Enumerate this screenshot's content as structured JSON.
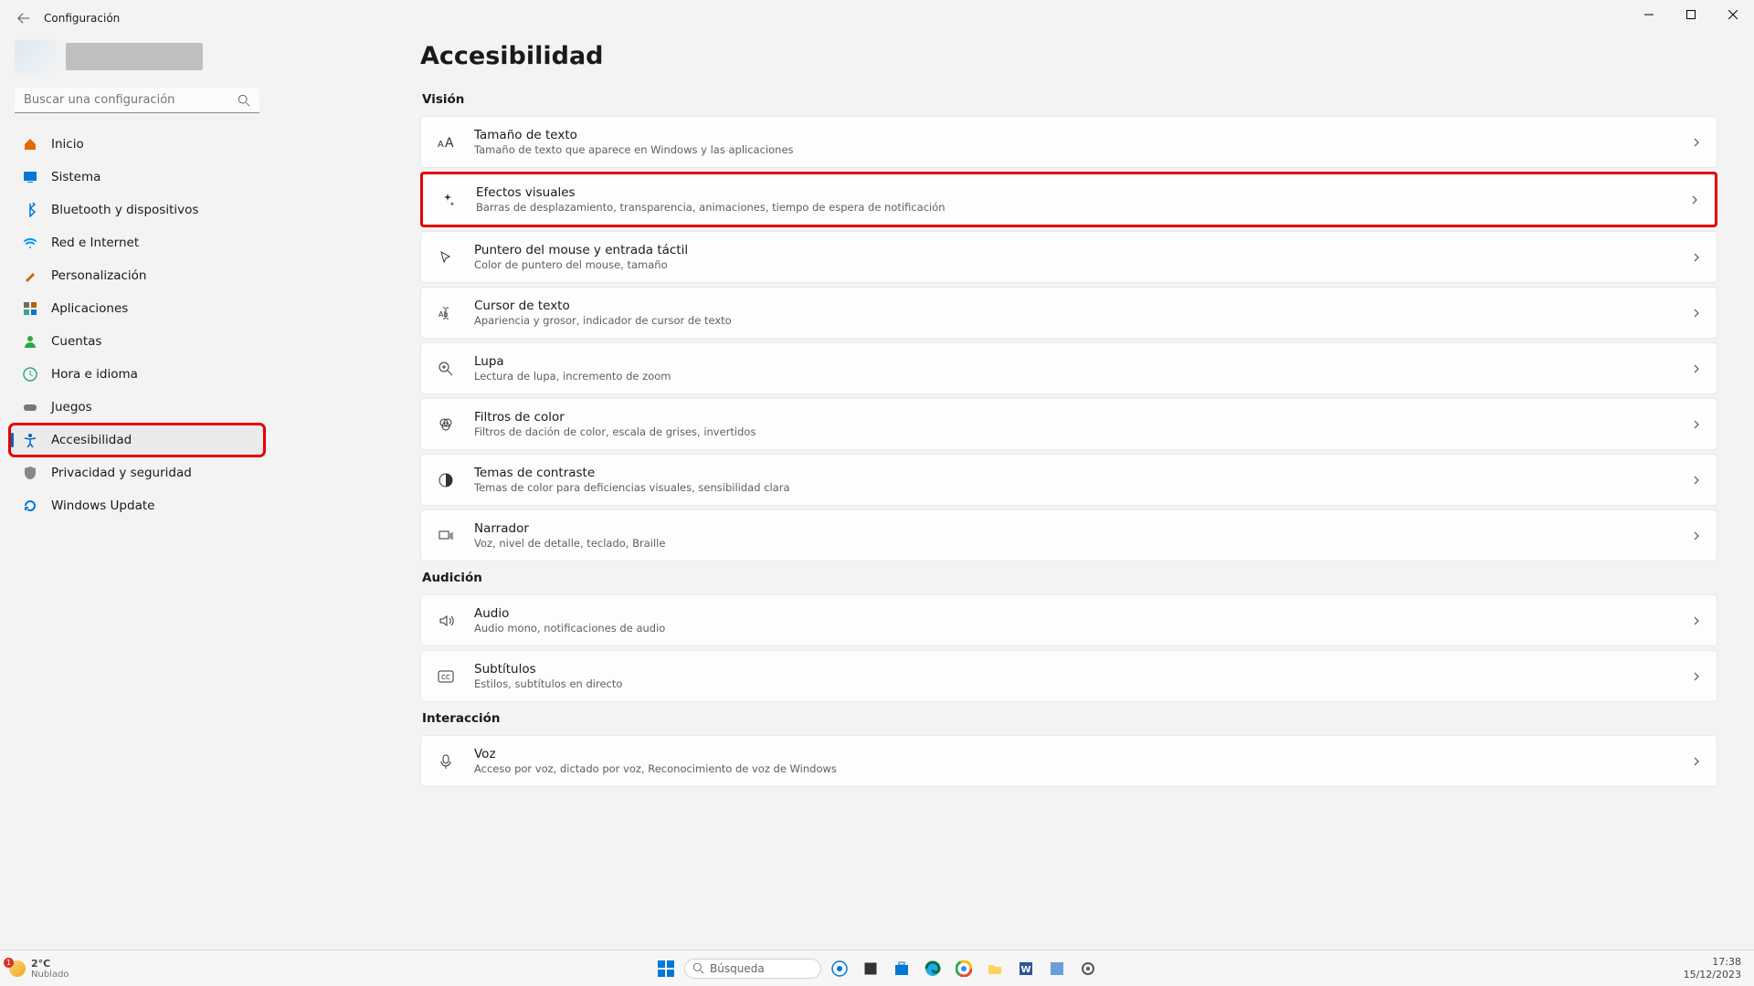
{
  "window": {
    "title": "Configuración"
  },
  "search": {
    "placeholder": "Buscar una configuración"
  },
  "sidebar": {
    "items": [
      {
        "label": "Inicio",
        "icon": "home",
        "color": "#e06c00"
      },
      {
        "label": "Sistema",
        "icon": "system",
        "color": "#0078d4"
      },
      {
        "label": "Bluetooth y dispositivos",
        "icon": "bluetooth",
        "color": "#0078d4"
      },
      {
        "label": "Red e Internet",
        "icon": "wifi",
        "color": "#0099ff"
      },
      {
        "label": "Personalización",
        "icon": "brush",
        "color": "#c46a00"
      },
      {
        "label": "Aplicaciones",
        "icon": "apps",
        "color": "#6b6b6b"
      },
      {
        "label": "Cuentas",
        "icon": "person",
        "color": "#2ba84a"
      },
      {
        "label": "Hora e idioma",
        "icon": "clock",
        "color": "#3a7"
      },
      {
        "label": "Juegos",
        "icon": "gamepad",
        "color": "#777"
      },
      {
        "label": "Accesibilidad",
        "icon": "accessibility",
        "color": "#0067c0",
        "active": true,
        "highlight": true
      },
      {
        "label": "Privacidad y seguridad",
        "icon": "shield",
        "color": "#888"
      },
      {
        "label": "Windows Update",
        "icon": "update",
        "color": "#0078d4"
      }
    ]
  },
  "main": {
    "title": "Accesibilidad",
    "sections": [
      {
        "title": "Visión",
        "cards": [
          {
            "title": "Tamaño de texto",
            "desc": "Tamaño de texto que aparece en Windows y las aplicaciones",
            "icon": "textsize"
          },
          {
            "title": "Efectos visuales",
            "desc": "Barras de desplazamiento, transparencia, animaciones, tiempo de espera de notificación",
            "icon": "sparkle",
            "highlight": true
          },
          {
            "title": "Puntero del mouse y entrada táctil",
            "desc": "Color de puntero del mouse, tamaño",
            "icon": "pointer"
          },
          {
            "title": "Cursor de texto",
            "desc": "Apariencia y grosor, indicador de cursor de texto",
            "icon": "textcursor"
          },
          {
            "title": "Lupa",
            "desc": "Lectura de lupa, incremento de zoom",
            "icon": "magnify"
          },
          {
            "title": "Filtros de color",
            "desc": "Filtros de dación de color, escala de grises, invertidos",
            "icon": "colorfilter"
          },
          {
            "title": "Temas de contraste",
            "desc": "Temas de color para deficiencias visuales, sensibilidad clara",
            "icon": "contrast"
          },
          {
            "title": "Narrador",
            "desc": "Voz, nivel de detalle, teclado, Braille",
            "icon": "narrator"
          }
        ]
      },
      {
        "title": "Audición",
        "cards": [
          {
            "title": "Audio",
            "desc": "Audio mono, notificaciones de audio",
            "icon": "audio"
          },
          {
            "title": "Subtítulos",
            "desc": "Estilos, subtítulos en directo",
            "icon": "cc"
          }
        ]
      },
      {
        "title": "Interacción",
        "cards": [
          {
            "title": "Voz",
            "desc": "Acceso por voz, dictado por voz, Reconocimiento de voz de Windows",
            "icon": "mic"
          }
        ]
      }
    ]
  },
  "taskbar": {
    "weather": {
      "temp": "2°C",
      "cond": "Nublado"
    },
    "search": "Búsqueda",
    "time": "17:38",
    "date": "15/12/2023"
  }
}
